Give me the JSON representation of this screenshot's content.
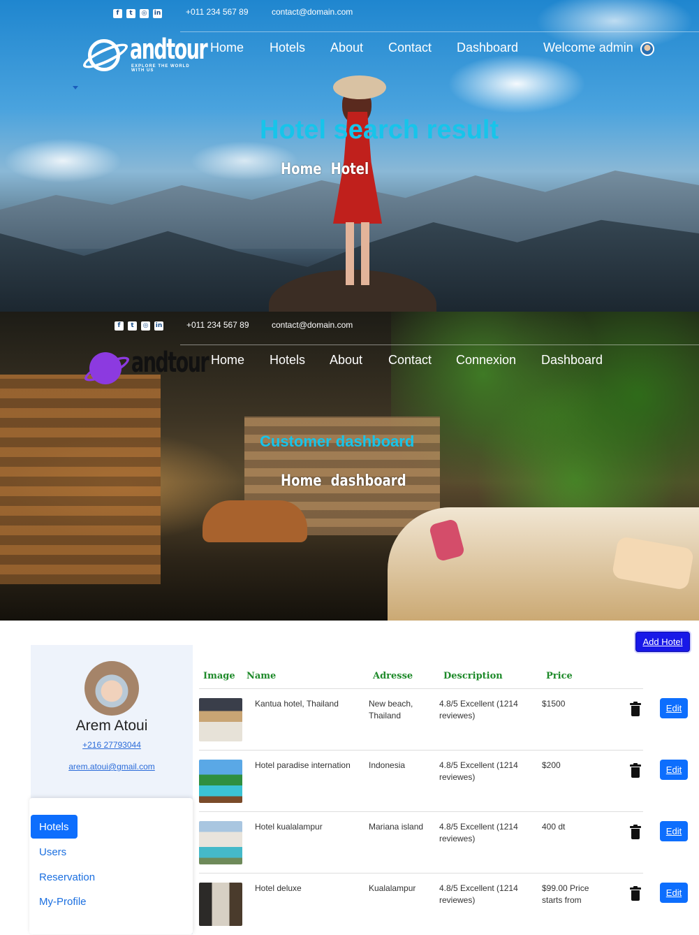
{
  "topbar": {
    "phone": "+011 234 567 89",
    "email": "contact@domain.com",
    "socials": [
      "facebook-icon",
      "twitter-icon",
      "instagram-icon",
      "linkedin-icon"
    ]
  },
  "brand": {
    "name": "andtour",
    "tagline": "EXPLORE THE WORLD WITH US"
  },
  "hero1": {
    "nav": [
      "Home",
      "Hotels",
      "About",
      "Contact",
      "Dashboard",
      "Welcome admin"
    ],
    "title": "Hotel search result",
    "breadcrumb": [
      "Home",
      "Hotel"
    ]
  },
  "hero2": {
    "nav": [
      "Home",
      "Hotels",
      "About",
      "Contact",
      "Connexion",
      "Dashboard"
    ],
    "title": "Customer dashboard",
    "breadcrumb": [
      "Home",
      "dashboard"
    ]
  },
  "actions": {
    "add_hotel": "Add Hotel"
  },
  "profile": {
    "name": "Arem Atoui",
    "phone": "+216 27793044",
    "email": "arem.atoui@gmail.com"
  },
  "side_menu": [
    "Hotels",
    "Users",
    "Reservation",
    "My-Profile"
  ],
  "table": {
    "headers": [
      "Image",
      "Name",
      "Adresse",
      "Description",
      "Price"
    ],
    "rows": [
      {
        "name": "Kantua hotel, Thailand",
        "address": "New beach, Thailand",
        "description": "4.8/5 Excellent (1214 reviewes)",
        "price": "$1500",
        "edit": "Edit"
      },
      {
        "name": "Hotel paradise internation",
        "address": "Indonesia",
        "description": "4.8/5 Excellent (1214 reviewes)",
        "price": "$200",
        "edit": "Edit"
      },
      {
        "name": "Hotel kualalampur",
        "address": "Mariana island",
        "description": "4.8/5 Excellent (1214 reviewes)",
        "price": "400 dt",
        "edit": "Edit"
      },
      {
        "name": "Hotel deluxe",
        "address": "Kualalampur",
        "description": "4.8/5 Excellent (1214 reviewes)",
        "price": "$99.00 Price starts from",
        "edit": "Edit"
      }
    ]
  },
  "colors": {
    "hero_title": "#17c4ea",
    "primary": "#0d6efd",
    "add_button": "#1818e8",
    "table_header": "#1e8a2a"
  }
}
